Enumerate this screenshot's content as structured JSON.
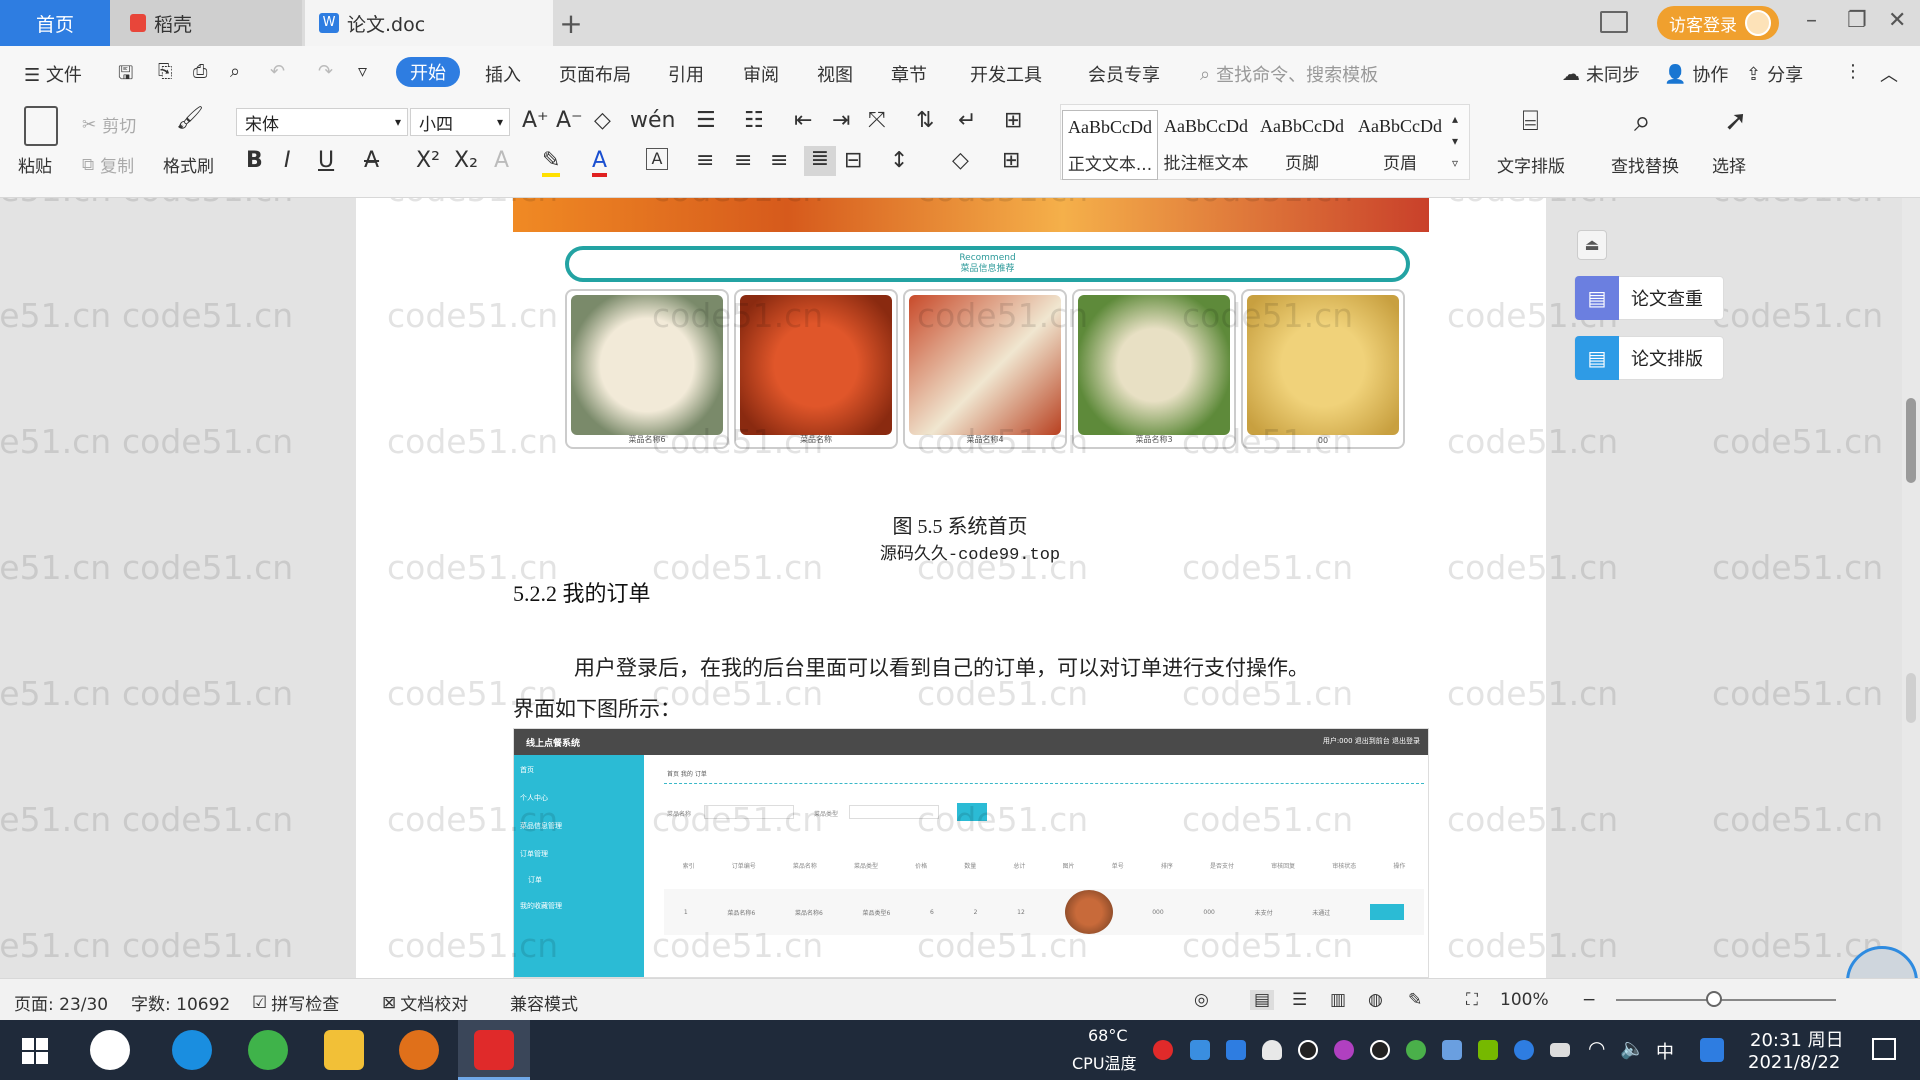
{
  "tabs": {
    "home": "首页",
    "daoke": "稻壳",
    "doc": "论文.doc"
  },
  "visitor_login": "访客登录",
  "menu": {
    "file": "文件",
    "start": "开始",
    "insert": "插入",
    "layout": "页面布局",
    "reference": "引用",
    "review": "审阅",
    "view": "视图",
    "chapter": "章节",
    "devtools": "开发工具",
    "member": "会员专享",
    "search_placeholder": "查找命令、搜索模板",
    "sync": "未同步",
    "collab": "协作",
    "share": "分享"
  },
  "ribbon": {
    "paste": "粘贴",
    "cut": "剪切",
    "copy": "复制",
    "format_painter": "格式刷",
    "font_name": "宋体",
    "font_size": "小四",
    "styles": [
      {
        "preview": "AaBbCcDd",
        "label": "正文文本..."
      },
      {
        "preview": "AaBbCcDd",
        "label": "批注框文本"
      },
      {
        "preview": "AaBbCcDd",
        "label": "页脚"
      },
      {
        "preview": "AaBbCcDd",
        "label": "页眉"
      }
    ],
    "text_layout": "文字排版",
    "find_replace": "查找替换",
    "select": "选择"
  },
  "watermark": "code51.cn",
  "document": {
    "recommend_title": "Recommend",
    "recommend_sub": "菜品信息推荐",
    "foods": [
      {
        "caption": "菜品名称6",
        "color": "#eae4d8"
      },
      {
        "caption": "菜品名称",
        "color": "#c8441e"
      },
      {
        "caption": "菜品名称4",
        "color": "#b8532b"
      },
      {
        "caption": "菜品名称3",
        "color": "#9aa65a"
      },
      {
        "caption": "00",
        "color": "#e6c46a"
      }
    ],
    "figure_caption": "图 5.5  系统首页",
    "figure_source": "源码久久-code99.top",
    "heading": "5.2.2  我的订单",
    "para_line1": "用户登录后，在我的后台里面可以看到自己的订单，可以对订单进行支付操作。",
    "para_line2": "界面如下图所示：",
    "shot": {
      "title": "线上点餐系统",
      "top_right": "用户:000   退出到前台   退出登录",
      "side": [
        "首页",
        "个人中心",
        "菜品信息管理",
        "订单管理",
        "订单",
        "我的收藏管理"
      ],
      "breadcrumb": "首页  我的  订单",
      "search_label1": "菜品名称",
      "search_label2": "菜品类型",
      "cols": [
        "索引",
        "订单编号",
        "菜品名称",
        "菜品类型",
        "价格",
        "数量",
        "总计",
        "图片",
        "单号",
        "排序",
        "是否支付",
        "审核回复",
        "审核状态",
        "操作"
      ],
      "row": [
        "1",
        "菜品名称6",
        "菜品名称6",
        "菜品类型6",
        "6",
        "2",
        "12",
        "000",
        "000",
        "未支付",
        "未通过"
      ]
    }
  },
  "right_panel": {
    "check": "论文查重",
    "layout": "论文排版"
  },
  "status": {
    "page": "页面: 23/30",
    "words": "字数: 10692",
    "spell": "拼写检查",
    "proof": "文档校对",
    "compat": "兼容模式",
    "zoom": "100%"
  },
  "taskbar": {
    "temp": "68°C",
    "temp_label": "CPU温度",
    "ime": "中",
    "time": "20:31 周日",
    "date": "2021/8/22"
  }
}
